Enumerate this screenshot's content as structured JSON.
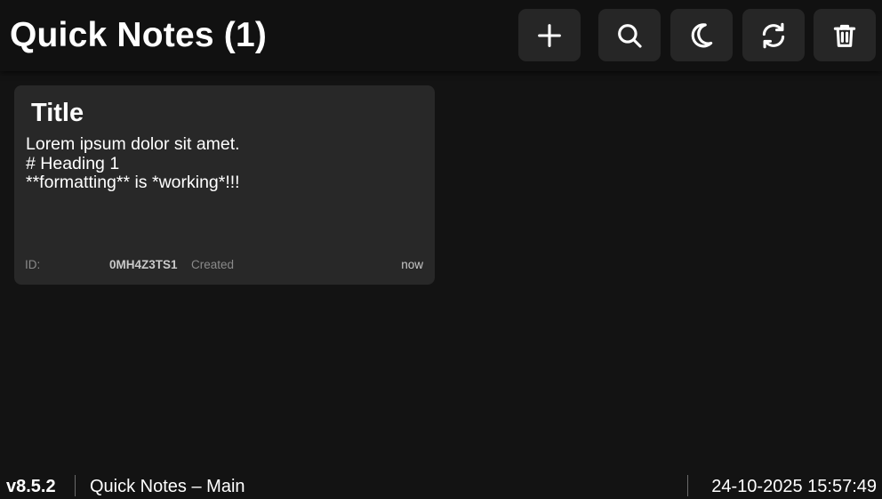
{
  "header": {
    "title": "Quick Notes (1)",
    "buttons": [
      {
        "icon": "plus-icon"
      },
      {
        "icon": "search-icon"
      },
      {
        "icon": "moon-icon"
      },
      {
        "icon": "refresh-icon"
      },
      {
        "icon": "trash-icon"
      }
    ]
  },
  "notes": [
    {
      "title": "Title",
      "body_lines": [
        "Lorem ipsum dolor sit amet.",
        "# Heading 1",
        "**formatting** is *working*!!!"
      ],
      "id_label": "ID:",
      "id_value": "0MH4Z3TS1",
      "created_label": "Created",
      "created_value": "now"
    }
  ],
  "footer": {
    "version": "v8.5.2",
    "app_name": "Quick Notes – Main",
    "datetime": "24-10-2025 15:57:49"
  },
  "colors": {
    "background": "#131313",
    "header_background": "#111111",
    "button_background": "#262626",
    "card_background": "#282828",
    "text": "#ffffff",
    "muted_text": "#8a8a8a"
  }
}
